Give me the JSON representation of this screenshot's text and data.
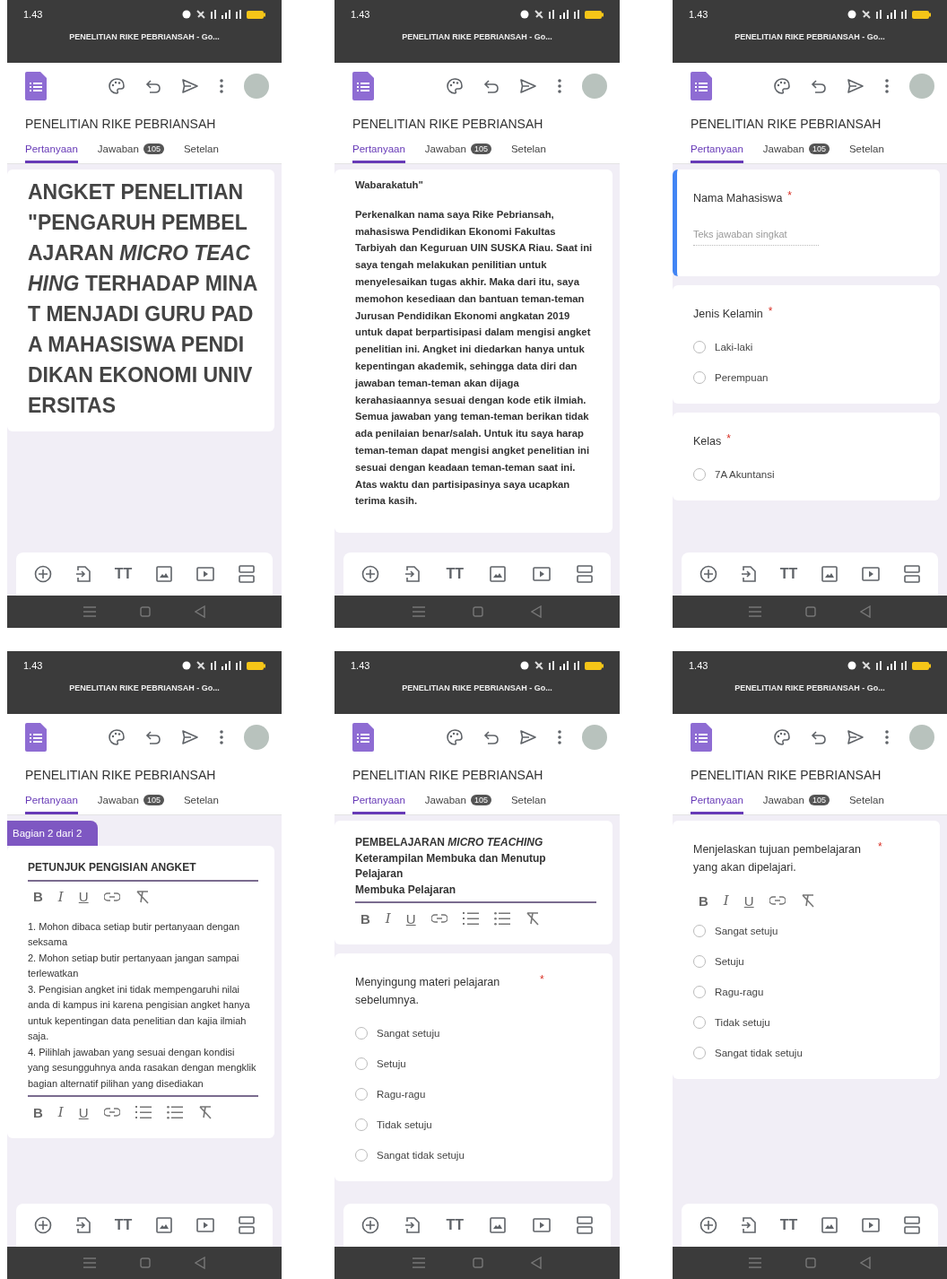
{
  "screens": [
    {
      "time": "1.43",
      "app_title": "PENELITIAN RIKE PEBRIANSAH - Go...",
      "form_title": "PENELITIAN RIKE PEBRIANSAH",
      "tabs": [
        {
          "label": "Pertanyaan",
          "selected": true
        },
        {
          "label": "Jawaban",
          "badge": "105",
          "selected": false
        },
        {
          "label": "Setelan",
          "selected": false
        }
      ],
      "content": [
        {
          "kind": "card",
          "focused": false,
          "items": [
            {
              "kind": "heading",
              "text": "ANGKET PENELITIAN \"PENGARUH PEMBELAJARAN *MICRO TEACHING* TERHADAP MINAT MENJADI GURU PADA MAHASISWA PENDIDIKAN EKONOMI UNIVERSITAS"
            }
          ]
        }
      ],
      "text_tool": "TT"
    },
    {
      "time": "1.43",
      "app_title": "PENELITIAN RIKE PEBRIANSAH - Go...",
      "form_title": "PENELITIAN RIKE PEBRIANSAH",
      "tabs": [
        {
          "label": "Pertanyaan",
          "selected": true
        },
        {
          "label": "Jawaban",
          "badge": "105",
          "selected": false
        },
        {
          "label": "Setelan",
          "selected": false
        }
      ],
      "content": [
        {
          "kind": "card",
          "focused": false,
          "items": [
            {
              "kind": "paragraph",
              "bold": true,
              "text": "Wabarakatuh\""
            },
            {
              "kind": "paragraph",
              "bold": true,
              "text": "Perkenalkan nama saya Rike Pebriansah, mahasiswa Pendidikan Ekonomi Fakultas Tarbiyah dan Keguruan UIN SUSKA Riau. Saat ini saya tengah melakukan penilitian untuk menyelesaikan tugas akhir. Maka dari itu, saya memohon kesediaan dan bantuan teman-teman Jurusan Pendidikan Ekonomi angkatan 2019 untuk dapat berpartisipasi dalam mengisi angket penelitian ini. Angket ini diedarkan hanya untuk kepentingan akademik, sehingga data diri dan jawaban teman-teman akan dijaga kerahasiaannya sesuai dengan kode etik ilmiah. Semua jawaban yang teman-teman berikan tidak ada penilaian benar/salah. Untuk itu saya harap teman-teman dapat mengisi angket penelitian ini sesuai dengan keadaan teman-teman saat ini. Atas waktu dan partisipasinya saya ucapkan terima kasih."
            }
          ]
        }
      ],
      "text_tool": "TT"
    },
    {
      "time": "1.43",
      "app_title": "PENELITIAN RIKE PEBRIANSAH - Go...",
      "form_title": "PENELITIAN RIKE PEBRIANSAH",
      "tabs": [
        {
          "label": "Pertanyaan",
          "selected": true
        },
        {
          "label": "Jawaban",
          "badge": "105",
          "selected": false
        },
        {
          "label": "Setelan",
          "selected": false
        }
      ],
      "content": [
        {
          "kind": "card",
          "focused": true,
          "items": [
            {
              "kind": "question",
              "text": "Nama Mahasiswa",
              "required_mark": "*"
            },
            {
              "kind": "short_answer",
              "placeholder": "Teks jawaban singkat"
            }
          ]
        },
        {
          "kind": "card",
          "focused": false,
          "items": [
            {
              "kind": "question",
              "text": "Jenis Kelamin",
              "required_mark": "*"
            },
            {
              "kind": "option",
              "label": "Laki-laki",
              "selected": false
            },
            {
              "kind": "option",
              "label": "Perempuan",
              "selected": false
            }
          ]
        },
        {
          "kind": "card",
          "focused": false,
          "items": [
            {
              "kind": "question",
              "text": "Kelas",
              "required_mark": "*"
            },
            {
              "kind": "option",
              "label": "7A Akuntansi",
              "selected": false
            }
          ]
        }
      ],
      "text_tool": "TT"
    },
    {
      "time": "1.43",
      "app_title": "PENELITIAN RIKE PEBRIANSAH - Go...",
      "form_title": "PENELITIAN RIKE PEBRIANSAH",
      "tabs": [
        {
          "label": "Pertanyaan",
          "selected": true
        },
        {
          "label": "Jawaban",
          "badge": "105",
          "selected": false
        },
        {
          "label": "Setelan",
          "selected": false
        }
      ],
      "content": [
        {
          "kind": "tag",
          "label": "Bagian 2 dari 2"
        },
        {
          "kind": "card",
          "focused": false,
          "items": [
            {
              "kind": "editor",
              "bold": true,
              "lines": [
                "PETUNJUK PENGISIAN ANGKET"
              ]
            },
            {
              "kind": "format_toolbar",
              "letters": [
                "B",
                "I",
                "U"
              ],
              "lists": false
            },
            {
              "kind": "editor",
              "bold": false,
              "lines": [
                "1. Mohon dibaca setiap butir pertanyaan dengan seksama",
                "2. Mohon setiap butir pertanyaan jangan sampai terlewatkan",
                "3. Pengisian angket ini tidak mempengaruhi nilai anda di kampus ini karena pengisian angket hanya untuk kepentingan data penelitian dan kajia ilmiah saja.",
                "4. Pilihlah jawaban yang sesuai dengan kondisi yang sesungguhnya anda rasakan dengan mengklik bagian alternatif pilihan yang disediakan"
              ]
            },
            {
              "kind": "format_toolbar",
              "letters": [
                "B",
                "I",
                "U"
              ],
              "lists": true
            }
          ]
        }
      ],
      "text_tool": "TT"
    },
    {
      "time": "1.43",
      "app_title": "PENELITIAN RIKE PEBRIANSAH - Go...",
      "form_title": "PENELITIAN RIKE PEBRIANSAH",
      "tabs": [
        {
          "label": "Pertanyaan",
          "selected": true
        },
        {
          "label": "Jawaban",
          "badge": "105",
          "selected": false
        },
        {
          "label": "Setelan",
          "selected": false
        }
      ],
      "content": [
        {
          "kind": "card",
          "focused": false,
          "items": [
            {
              "kind": "editor",
              "bold": true,
              "lines": [
                "PEMBELAJARAN *MICRO TEACHING*",
                "Keterampilan Membuka dan Menutup Pelajaran",
                "Membuka Pelajaran"
              ]
            },
            {
              "kind": "format_toolbar",
              "letters": [
                "B",
                "I",
                "U"
              ],
              "lists": true
            }
          ]
        },
        {
          "kind": "card",
          "focused": false,
          "items": [
            {
              "kind": "question",
              "text": "Menyingung materi pelajaran sebelumnya.",
              "required_mark": "*"
            },
            {
              "kind": "option",
              "label": "Sangat setuju",
              "selected": false
            },
            {
              "kind": "option",
              "label": "Setuju",
              "selected": false
            },
            {
              "kind": "option",
              "label": "Ragu-ragu",
              "selected": false
            },
            {
              "kind": "option",
              "label": "Tidak setuju",
              "selected": false
            },
            {
              "kind": "option",
              "label": "Sangat tidak setuju",
              "selected": false
            }
          ]
        }
      ],
      "text_tool": "TT"
    },
    {
      "time": "1.43",
      "app_title": "PENELITIAN RIKE PEBRIANSAH - Go...",
      "form_title": "PENELITIAN RIKE PEBRIANSAH",
      "tabs": [
        {
          "label": "Pertanyaan",
          "selected": true
        },
        {
          "label": "Jawaban",
          "badge": "105",
          "selected": false
        },
        {
          "label": "Setelan",
          "selected": false
        }
      ],
      "content": [
        {
          "kind": "card",
          "focused": false,
          "items": [
            {
              "kind": "question",
              "text": "Menjelaskan tujuan pembelajaran yang akan dipelajari.",
              "required_mark": "*"
            },
            {
              "kind": "format_toolbar",
              "letters": [
                "B",
                "I",
                "U"
              ],
              "lists": false
            },
            {
              "kind": "option",
              "label": "Sangat setuju",
              "selected": false
            },
            {
              "kind": "option",
              "label": "Setuju",
              "selected": false
            },
            {
              "kind": "option",
              "label": "Ragu-ragu",
              "selected": false
            },
            {
              "kind": "option",
              "label": "Tidak setuju",
              "selected": false
            },
            {
              "kind": "option",
              "label": "Sangat tidak setuju",
              "selected": false
            }
          ]
        }
      ],
      "text_tool": "TT"
    }
  ]
}
